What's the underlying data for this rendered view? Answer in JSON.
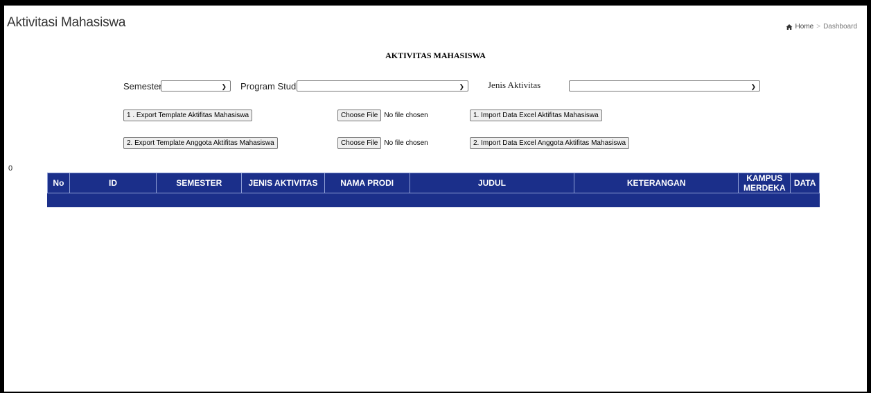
{
  "header": {
    "page_title": "Aktivitasi Mahasiswa",
    "breadcrumb": {
      "icon": "home-icon",
      "home": "Home",
      "separator": ">",
      "current": "Dashboard"
    }
  },
  "form": {
    "title": "AKTIVITAS MAHASISWA",
    "semester": {
      "label": "Semester",
      "value": ""
    },
    "program_studi": {
      "label": "Program Studi",
      "value": ""
    },
    "jenis_aktivitas": {
      "label": "Jenis Aktivitas",
      "value": ""
    },
    "row1": {
      "export_label": "1 . Export Template Aktifitas Mahasiswa",
      "choose_file_label": "Choose File",
      "file_status": "No file chosen",
      "import_label": "1. Import Data Excel Aktifitas Mahasiswa"
    },
    "row2": {
      "export_label": "2. Export Template Anggota Aktifitas Mahasiswa",
      "choose_file_label": "Choose File",
      "file_status": "No file chosen",
      "import_label": "2. Import Data Excel Anggota Aktifitas Mahasiswa"
    }
  },
  "record_count": "0",
  "table": {
    "header_color": "#1b2f8a",
    "columns": [
      "No",
      "ID",
      "SEMESTER",
      "JENIS AKTIVITAS",
      "NAMA PRODI",
      "JUDUL",
      "KETERANGAN",
      "KAMPUS MERDEKA",
      "DATA"
    ],
    "rows": []
  }
}
